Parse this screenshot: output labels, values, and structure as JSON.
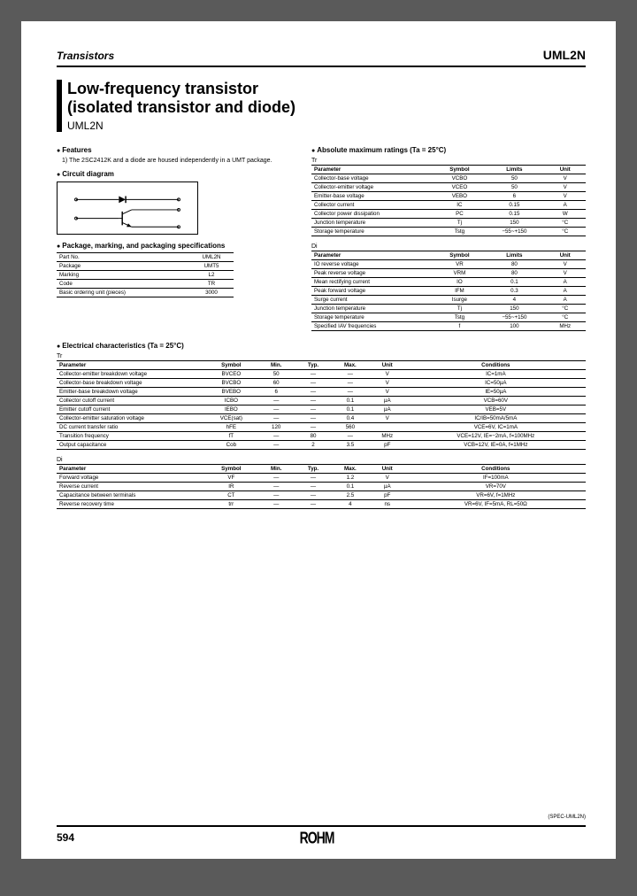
{
  "header": {
    "category": "Transistors",
    "part": "UML2N"
  },
  "title": {
    "line1": "Low-frequency transistor",
    "line2": "(isolated transistor and diode)",
    "sub": "UML2N"
  },
  "features": {
    "head": "Features",
    "text": "1) The 2SC2412K and a diode are housed independently in a UMT package."
  },
  "circuit_head": "Circuit diagram",
  "pkg": {
    "head": "Package, marking, and packaging specifications",
    "rows": [
      [
        "Part No.",
        "UML2N"
      ],
      [
        "Package",
        "UMT5"
      ],
      [
        "Marking",
        "L2"
      ],
      [
        "Code",
        "TR"
      ],
      [
        "Basic ordering unit (pieces)",
        "3000"
      ]
    ]
  },
  "abs": {
    "head": "Absolute maximum ratings (Ta = 25°C)",
    "tr_label": "Tr",
    "di_label": "Di",
    "cols": [
      "Parameter",
      "Symbol",
      "Limits",
      "Unit"
    ],
    "tr_rows": [
      [
        "Collector-base voltage",
        "VCBO",
        "50",
        "V"
      ],
      [
        "Collector-emitter voltage",
        "VCEO",
        "50",
        "V"
      ],
      [
        "Emitter-base voltage",
        "VEBO",
        "6",
        "V"
      ],
      [
        "Collector current",
        "IC",
        "0.15",
        "A"
      ],
      [
        "Collector power dissipation",
        "PC",
        "0.15",
        "W"
      ],
      [
        "Junction temperature",
        "Tj",
        "150",
        "°C"
      ],
      [
        "Storage temperature",
        "Tstg",
        "−55~+150",
        "°C"
      ]
    ],
    "di_rows": [
      [
        "IO reverse voltage",
        "VR",
        "80",
        "V"
      ],
      [
        "Peak reverse voltage",
        "VRM",
        "80",
        "V"
      ],
      [
        "Mean rectifying current",
        "IO",
        "0.1",
        "A"
      ],
      [
        "Peak forward voltage",
        "IFM",
        "0.3",
        "A"
      ],
      [
        "Surge current",
        "Isurge",
        "4",
        "A"
      ],
      [
        "Junction temperature",
        "Tj",
        "150",
        "°C"
      ],
      [
        "Storage temperature",
        "Tstg",
        "−55~+150",
        "°C"
      ],
      [
        "Specified IAV frequencies",
        "f",
        "100",
        "MHz"
      ]
    ]
  },
  "elec": {
    "head": "Electrical characteristics (Ta = 25°C)",
    "tr_label": "Tr",
    "di_label": "Di",
    "cols": [
      "Parameter",
      "Symbol",
      "Min.",
      "Typ.",
      "Max.",
      "Unit",
      "Conditions"
    ],
    "tr_rows": [
      [
        "Collector-emitter breakdown voltage",
        "BVCEO",
        "50",
        "—",
        "—",
        "V",
        "IC=1mA"
      ],
      [
        "Collector-base breakdown voltage",
        "BVCBO",
        "60",
        "—",
        "—",
        "V",
        "IC=50µA"
      ],
      [
        "Emitter-base breakdown voltage",
        "BVEBO",
        "6",
        "—",
        "—",
        "V",
        "IE=50µA"
      ],
      [
        "Collector cutoff current",
        "ICBO",
        "—",
        "—",
        "0.1",
        "µA",
        "VCB=60V"
      ],
      [
        "Emitter cutoff current",
        "IEBO",
        "—",
        "—",
        "0.1",
        "µA",
        "VEB=5V"
      ],
      [
        "Collector-emitter saturation voltage",
        "VCE(sat)",
        "—",
        "—",
        "0.4",
        "V",
        "IC/IB=50mA/5mA"
      ],
      [
        "DC current transfer ratio",
        "hFE",
        "120",
        "—",
        "560",
        "",
        "VCE=6V, IC=1mA"
      ],
      [
        "Transition frequency",
        "fT",
        "—",
        "80",
        "—",
        "MHz",
        "VCE=12V, IE=−2mA, f=100MHz"
      ],
      [
        "Output capacitance",
        "Cob",
        "—",
        "2",
        "3.5",
        "pF",
        "VCB=12V, IE=0A, f=1MHz"
      ]
    ],
    "di_rows": [
      [
        "Forward voltage",
        "VF",
        "—",
        "—",
        "1.2",
        "V",
        "IF=100mA"
      ],
      [
        "Reverse current",
        "IR",
        "—",
        "—",
        "0.1",
        "µA",
        "VR=70V"
      ],
      [
        "Capacitance between terminals",
        "CT",
        "—",
        "—",
        "2.5",
        "pF",
        "VR=6V, f=1MHz"
      ],
      [
        "Reverse recovery time",
        "trr",
        "—",
        "—",
        "4",
        "ns",
        "VR=6V, IF=5mA, RL=50Ω"
      ]
    ]
  },
  "spec_code": "(SPEC-UML2N)",
  "footer": {
    "page": "594",
    "brand": "ROHM"
  }
}
